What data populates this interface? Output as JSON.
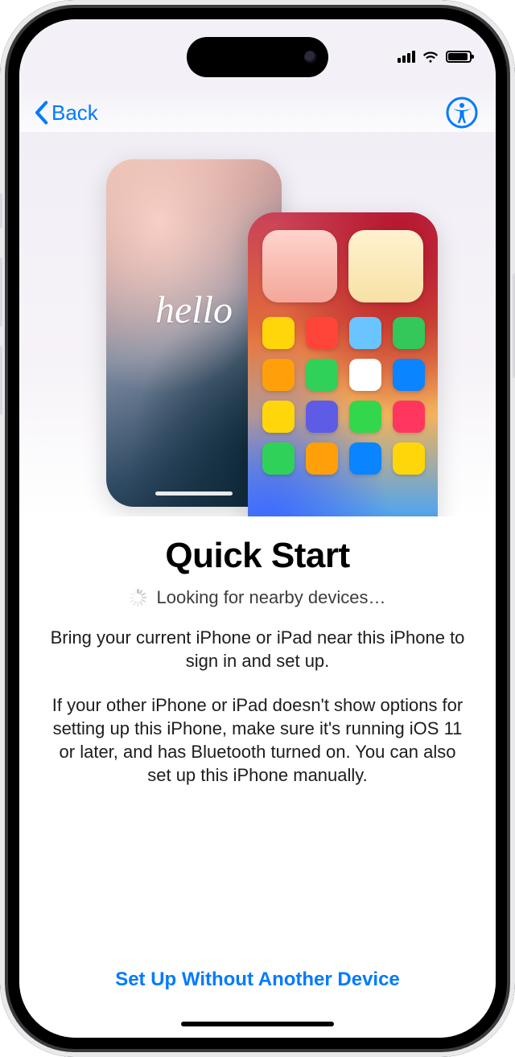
{
  "nav": {
    "back_label": "Back"
  },
  "hero": {
    "hello_text": "hello"
  },
  "content": {
    "title": "Quick Start",
    "status": "Looking for nearby devices…",
    "paragraph1": "Bring your current iPhone or iPad near this iPhone to sign in and set up.",
    "paragraph2": "If your other iPhone or iPad doesn't show options for setting up this iPhone, make sure it's running iOS 11 or later, and has Bluetooth turned on. You can also set up this iPhone manually."
  },
  "footer": {
    "alt_setup": "Set Up Without Another Device"
  }
}
